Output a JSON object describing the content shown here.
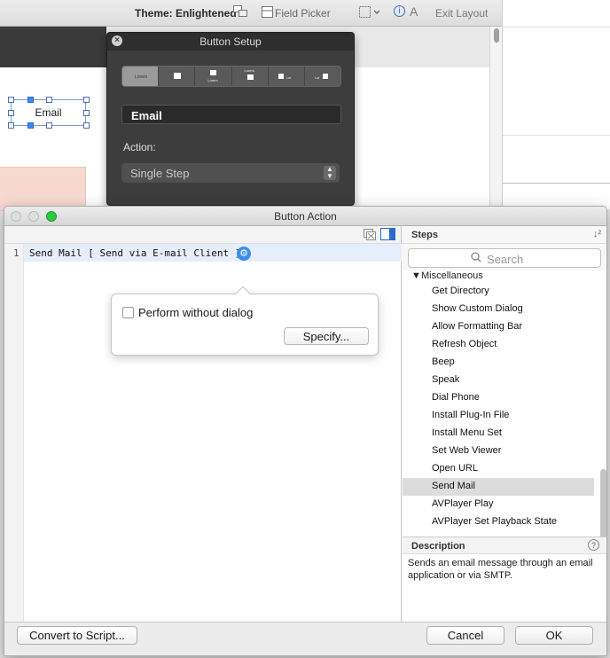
{
  "toolbar": {
    "theme_label": "Theme: Enlightened",
    "field_picker_label": "Field Picker",
    "exit_layout_label": "Exit Layout",
    "text_icon_label": "A",
    "info_icon_label": "i"
  },
  "layout_canvas": {
    "email_button_label": "Email"
  },
  "button_setup": {
    "title": "Button Setup",
    "style_segments": [
      "Lorem",
      "",
      "Lorem",
      "Lorem",
      "Lor",
      "Lor"
    ],
    "selected_segment": 0,
    "label_value": "Email",
    "action_label": "Action:",
    "action_value": "Single Step"
  },
  "button_action": {
    "title": "Button Action",
    "script": {
      "line_number": "1",
      "line_text": "Send Mail [ Send via E-mail Client ]"
    },
    "popover": {
      "checkbox_label": "Perform without dialog",
      "checkbox_checked": false,
      "specify_label": "Specify..."
    },
    "steps": {
      "header": "Steps",
      "search_placeholder": "Search",
      "category": "Miscellaneous",
      "items": [
        "Get Directory",
        "Show Custom Dialog",
        "Allow Formatting Bar",
        "Refresh Object",
        "Beep",
        "Speak",
        "Dial Phone",
        "Install Plug-In File",
        "Install Menu Set",
        "Set Web Viewer",
        "Open URL",
        "Send Mail",
        "AVPlayer Play",
        "AVPlayer Set Playback State"
      ],
      "selected_item": "Send Mail"
    },
    "description": {
      "header": "Description",
      "text": "Sends an email message through an email application or via SMTP."
    },
    "footer": {
      "convert_label": "Convert to Script...",
      "cancel_label": "Cancel",
      "ok_label": "OK"
    }
  },
  "colors": {
    "accent": "#3a8ee6",
    "panel_dark": "#3d3d3d",
    "selection_gray": "#dcdcdc",
    "close_green": "#2dc93e",
    "pink_field": "#f8d9cf"
  }
}
